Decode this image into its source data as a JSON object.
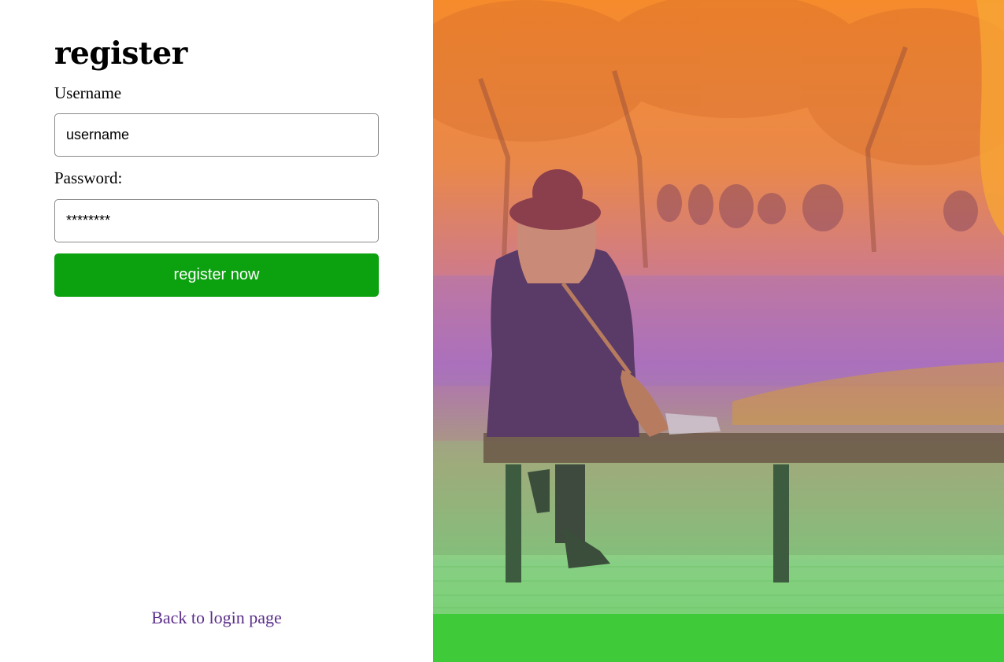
{
  "form": {
    "title": "register",
    "username_label": "Username",
    "username_value": "username",
    "password_label": "Password:",
    "password_value": "********",
    "submit_label": "register now",
    "back_link": "Back to login page"
  },
  "colors": {
    "submit_button": "#0ba10f",
    "link": "#5b2d8a",
    "hero_gradient": [
      "#f68b2c",
      "#b26fb6",
      "#3fca3a"
    ]
  },
  "hero_image": {
    "icon": "photo-woman-on-park-bench"
  }
}
